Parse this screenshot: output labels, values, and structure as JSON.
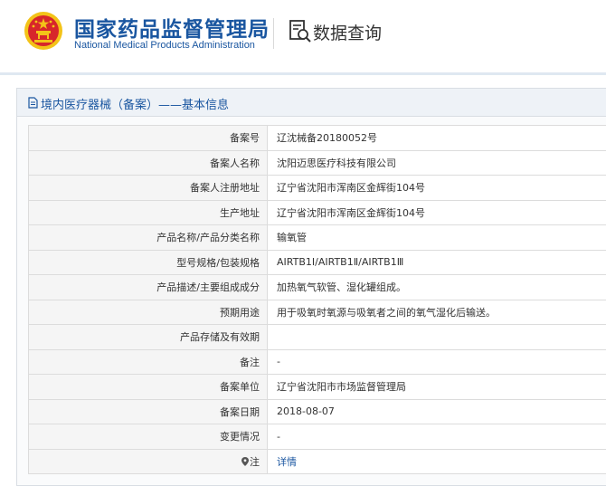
{
  "header": {
    "title_cn": "国家药品监督管理局",
    "title_en": "National Medical Products Administration",
    "query_label": "数据查询"
  },
  "panel": {
    "title": "境内医疗器械（备案）——基本信息"
  },
  "rows": [
    {
      "label": "备案号",
      "value": "辽沈械备20180052号"
    },
    {
      "label": "备案人名称",
      "value": "沈阳迈思医疗科技有限公司"
    },
    {
      "label": "备案人注册地址",
      "value": "辽宁省沈阳市浑南区金辉街104号"
    },
    {
      "label": "生产地址",
      "value": "辽宁省沈阳市浑南区金辉街104号"
    },
    {
      "label": "产品名称/产品分类名称",
      "value": "输氧管"
    },
    {
      "label": "型号规格/包装规格",
      "value": "AIRTB1Ⅰ/AIRTB1Ⅱ/AIRTB1Ⅲ"
    },
    {
      "label": "产品描述/主要组成成分",
      "value": "加热氧气软管、湿化罐组成。"
    },
    {
      "label": "预期用途",
      "value": "用于吸氧时氧源与吸氧者之间的氧气湿化后输送。"
    },
    {
      "label": "产品存储及有效期",
      "value": ""
    },
    {
      "label": "备注",
      "value": "-"
    },
    {
      "label": "备案单位",
      "value": "辽宁省沈阳市市场监督管理局"
    },
    {
      "label": "备案日期",
      "value": "2018-08-07"
    },
    {
      "label": "变更情况",
      "value": "-"
    },
    {
      "label": "注",
      "value": "详情"
    }
  ],
  "colors": {
    "brand_blue": "#1a56a0",
    "emblem_red": "#d7262b",
    "emblem_gold": "#f3c318"
  },
  "icons": {
    "emblem": "national-emblem-icon",
    "query": "data-query-icon",
    "doc": "document-icon",
    "pin": "location-pin-icon"
  }
}
